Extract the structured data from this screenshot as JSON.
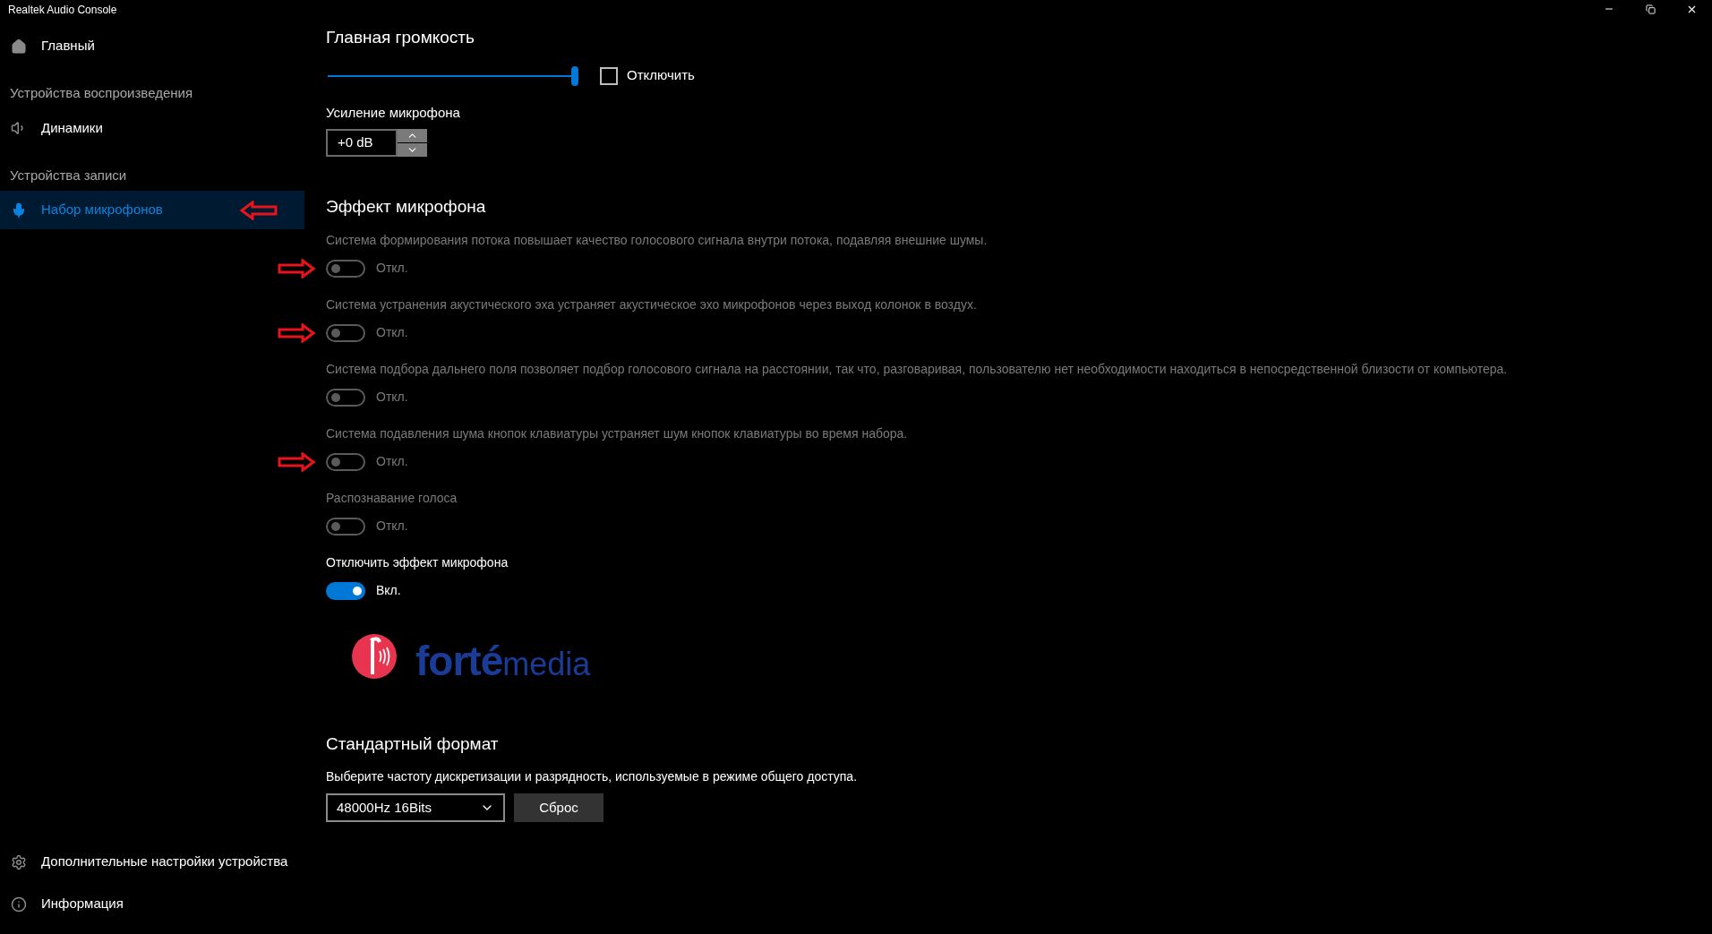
{
  "window": {
    "title": "Realtek Audio Console"
  },
  "sidebar": {
    "items": [
      {
        "kind": "nav",
        "label": "Главный",
        "selected": false,
        "marked": false
      },
      {
        "kind": "header",
        "label": "Устройства воспроизведения"
      },
      {
        "kind": "nav",
        "label": "Динамики",
        "selected": false,
        "marked": false
      },
      {
        "kind": "header",
        "label": "Устройства записи"
      },
      {
        "kind": "nav",
        "label": "Набор микрофонов",
        "selected": true,
        "marked": true
      }
    ],
    "footer": [
      {
        "label": "Дополнительные настройки устройства"
      },
      {
        "label": "Информация"
      }
    ]
  },
  "main_volume": {
    "title": "Главная громкость",
    "level": 1.0,
    "mute": {
      "label": "Отключить",
      "checked": false
    }
  },
  "mic_boost": {
    "label": "Усиление микрофона",
    "value": "+0 dB"
  },
  "mic_effect": {
    "title": "Эффект микрофона",
    "items": [
      {
        "description": "Система формирования потока повышает качество голосового сигнала внутри потока, подавляя внешние шумы.",
        "on": false,
        "disabled": true,
        "state_label": "Откл.",
        "marked": true
      },
      {
        "description": "Система устранения акустического эха устраняет акустическое эхо микрофонов через выход колонок в воздух.",
        "on": false,
        "disabled": true,
        "state_label": "Откл.",
        "marked": true
      },
      {
        "description": "Система подбора дальнего поля позволяет подбор голосового сигнала на расстоянии, так что, разговаривая, пользователю нет необходимости находиться в непосредственной близости от компьютера.",
        "on": false,
        "disabled": true,
        "state_label": "Откл.",
        "marked": false
      },
      {
        "description": "Система подавления шума кнопок клавиатуры устраняет шум кнопок клавиатуры во время набора.",
        "on": false,
        "disabled": true,
        "state_label": "Откл.",
        "marked": true
      },
      {
        "description": "Распознавание голоса",
        "on": false,
        "disabled": true,
        "state_label": "Откл.",
        "marked": false
      },
      {
        "description": "Отключить эффект микрофона",
        "on": true,
        "disabled": false,
        "state_label": "Вкл.",
        "marked": false
      }
    ],
    "logo": {
      "word": "forté",
      "suffix": "media"
    }
  },
  "default_format": {
    "title": "Стандартный формат",
    "description": "Выберите частоту дискретизации и разрядность, используемые в режиме общего доступа.",
    "value": "48000Hz 16Bits",
    "reset": "Сброс"
  }
}
